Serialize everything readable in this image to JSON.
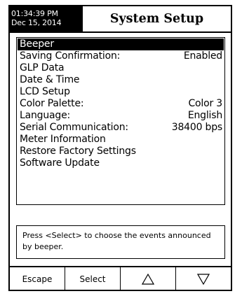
{
  "header": {
    "time": "01:34:39 PM",
    "date": "Dec 15, 2014",
    "title": "System Setup"
  },
  "menu": {
    "items": [
      {
        "label": "Beeper",
        "value": "",
        "selected": true
      },
      {
        "label": "Saving Confirmation:",
        "value": "Enabled"
      },
      {
        "label": "GLP Data",
        "value": ""
      },
      {
        "label": "Date & Time",
        "value": ""
      },
      {
        "label": "LCD Setup",
        "value": ""
      },
      {
        "label": "Color Palette:",
        "value": "Color 3"
      },
      {
        "label": "Language:",
        "value": "English"
      },
      {
        "label": "Serial Communication:",
        "value": "38400 bps"
      },
      {
        "label": "Meter Information",
        "value": ""
      },
      {
        "label": "Restore Factory Settings",
        "value": ""
      },
      {
        "label": "Software Update",
        "value": ""
      }
    ]
  },
  "hint": {
    "text": "Press <Select> to choose the events announced by beeper."
  },
  "softkeys": {
    "escape": "Escape",
    "select": "Select",
    "up_icon": "triangle-up-icon",
    "down_icon": "triangle-down-icon"
  }
}
